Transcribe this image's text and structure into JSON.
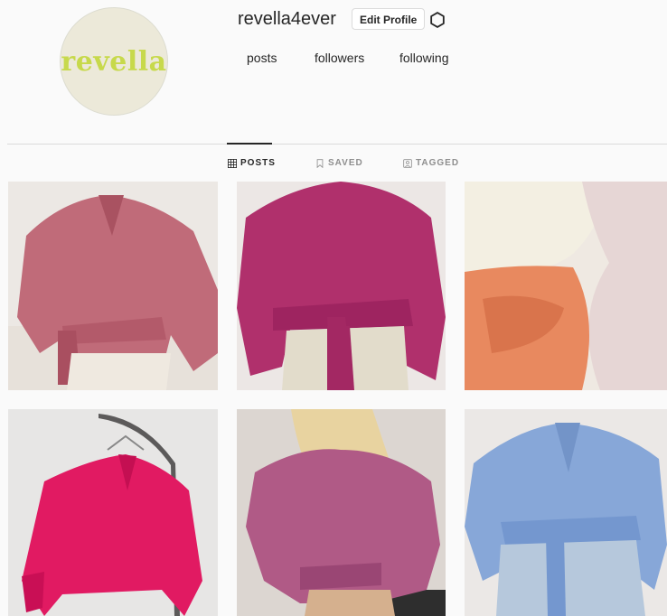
{
  "profile": {
    "avatar_text": "revella",
    "username": "revella4ever",
    "edit_button": "Edit Profile",
    "settings_icon": "gear-icon",
    "stats": {
      "posts": "posts",
      "followers": "followers",
      "following": "following"
    }
  },
  "tabs": [
    {
      "label": "POSTS",
      "icon": "grid-icon",
      "active": true
    },
    {
      "label": "SAVED",
      "icon": "bookmark-icon",
      "active": false
    },
    {
      "label": "TAGGED",
      "icon": "tag-icon",
      "active": false
    }
  ],
  "posts": [
    {
      "description": "dusty pink wrap shirt"
    },
    {
      "description": "magenta wrap shirt"
    },
    {
      "description": "folded silk shirts pile"
    },
    {
      "description": "hot pink shirt on hanger"
    },
    {
      "description": "mauve wrap shirt blonde"
    },
    {
      "description": "light blue wrap shirt"
    }
  ],
  "colors": {
    "background": "#fafafa",
    "text": "#262626",
    "muted": "#8e8e8e",
    "divider": "#dbdbdb",
    "logo_green": "#c7d94b"
  }
}
